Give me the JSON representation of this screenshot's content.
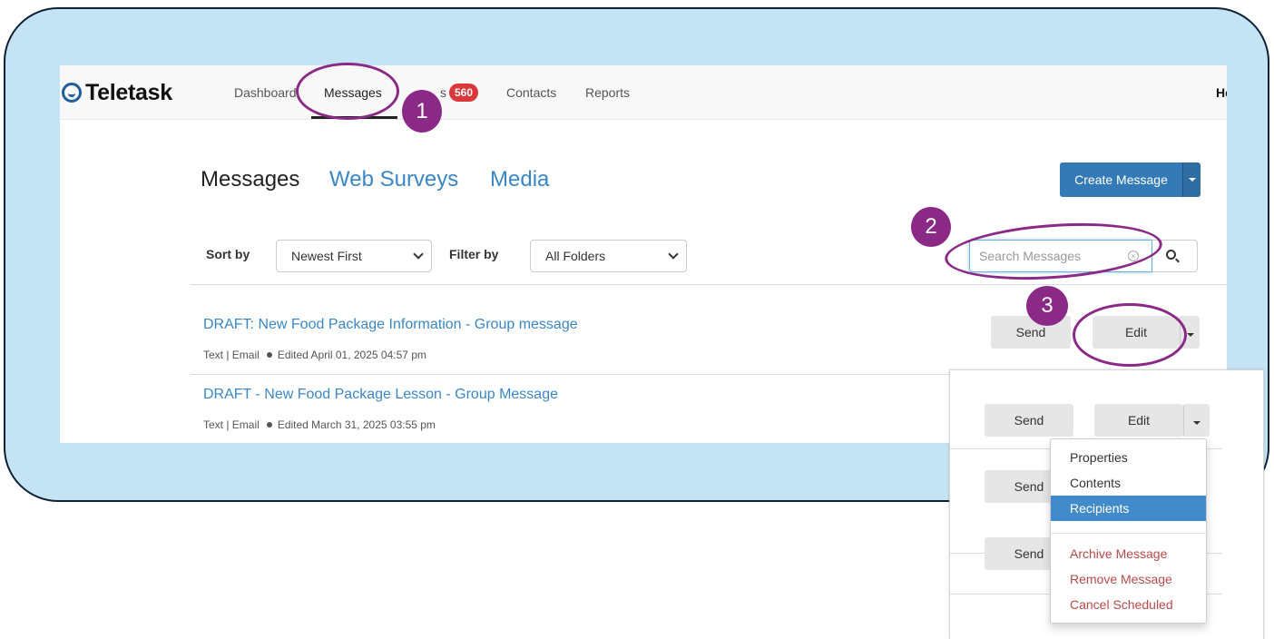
{
  "app": {
    "logo_text": "Teletask"
  },
  "nav": {
    "items": [
      "Dashboard",
      "Messages",
      "s",
      "Contacts",
      "Reports"
    ],
    "badge": "560",
    "user_partial": "He"
  },
  "tabs": [
    "Messages",
    "Web Surveys",
    "Media"
  ],
  "toolbar": {
    "create_label": "Create Message"
  },
  "filters": {
    "sort_label": "Sort by",
    "sort_value": "Newest First",
    "filter_label": "Filter by",
    "filter_value": "All Folders",
    "search_placeholder": "Search Messages"
  },
  "messages": [
    {
      "title": "DRAFT: New Food Package Information - Group message",
      "meta_type": "Text | Email",
      "meta_edited": "Edited April 01, 2025 04:57 pm"
    },
    {
      "title": "DRAFT - New Food Package Lesson - Group Message",
      "meta_type": "Text | Email",
      "meta_edited": "Edited March 31, 2025 03:55 pm"
    }
  ],
  "buttons": {
    "send": "Send",
    "edit": "Edit"
  },
  "dropdown_menu": {
    "items": [
      "Properties",
      "Contents",
      "Recipients"
    ],
    "danger_items": [
      "Archive Message",
      "Remove Message",
      "Cancel Scheduled"
    ],
    "active": "Recipients"
  },
  "annotations": [
    "1",
    "2",
    "3"
  ],
  "colors": {
    "accent": "#337ab7",
    "link": "#3a87c8",
    "annotation": "#8b2a86",
    "badge": "#d9373a",
    "backdrop": "#c4e4f3"
  }
}
